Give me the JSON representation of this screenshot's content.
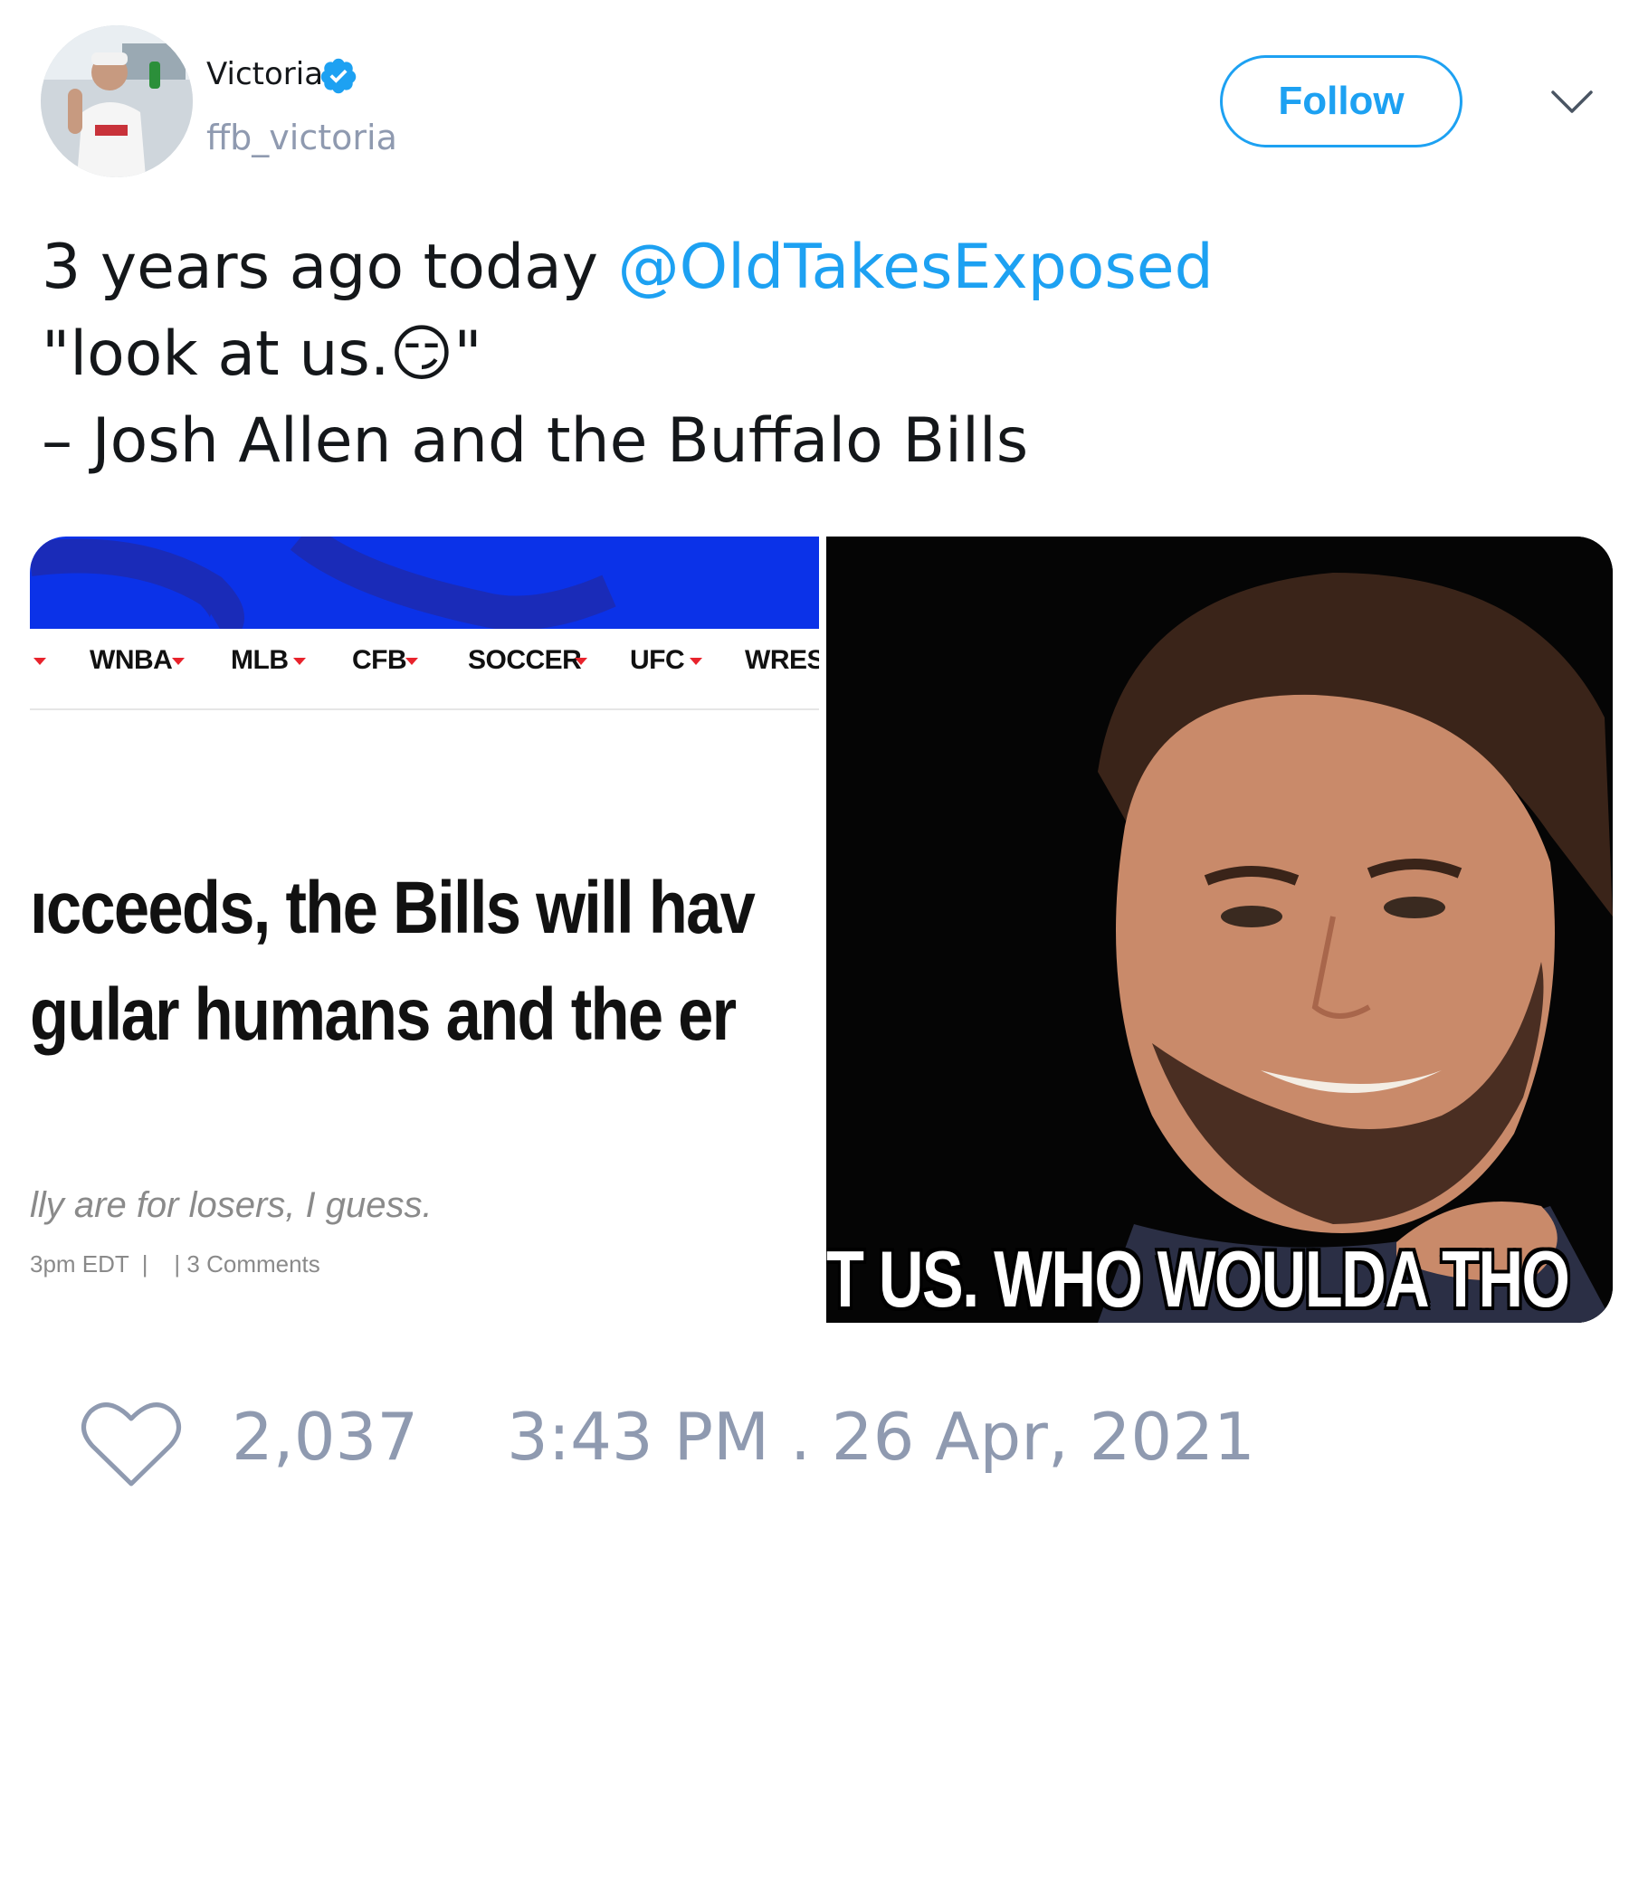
{
  "author": {
    "display_name": "Victoria",
    "handle": "ffb_victoria",
    "verified": true
  },
  "follow_button": {
    "label": "Follow"
  },
  "tweet": {
    "line1_prefix": "3 years ago today ",
    "mention": "@OldTakesExposed",
    "line2": "\"look at us.😏\"",
    "line3": "– Josh Allen and the Buffalo Bills"
  },
  "media": {
    "left_screenshot": {
      "nav_items": [
        "WNBA",
        "MLB",
        "CFB",
        "SOCCER",
        "UFC",
        "WREST"
      ],
      "headline_line1": "ıcceeds, the Bills will hav",
      "headline_line2": "gular humans and the er",
      "subtitle": "lly are for losers, I guess.",
      "meta": "3pm EDT  |    | 3 Comments"
    },
    "right_meme": {
      "caption": "T US. WHO WOULDA THO"
    }
  },
  "footer": {
    "like_count": "2,037",
    "timestamp": "3:43 PM . 26 Apr, 2021"
  },
  "colors": {
    "accent": "#1da1f2",
    "muted": "#8f9ab0",
    "banner_blue": "#0b32e8"
  },
  "icons": {
    "verified": "verified-badge-icon",
    "chevron": "chevron-down-icon",
    "like": "heart-icon"
  }
}
